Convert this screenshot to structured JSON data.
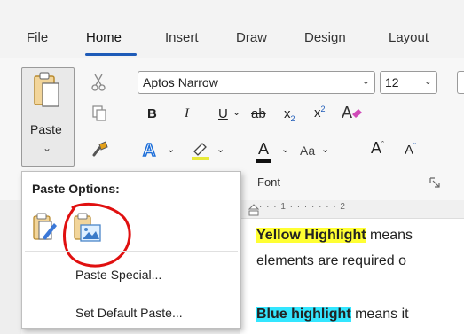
{
  "menu": {
    "items": [
      "File",
      "Home",
      "Insert",
      "Draw",
      "Design",
      "Layout"
    ],
    "active": "Home"
  },
  "clipboard": {
    "paste_label": "Paste",
    "icons": [
      "paste-icon",
      "cut-icon",
      "copy-icon",
      "format-painter-icon",
      "chevron-down-icon"
    ]
  },
  "font": {
    "name": "Aptos Narrow",
    "size": "12",
    "group_label": "Font",
    "bold": "B",
    "italic": "I",
    "underline": "U",
    "strike": "ab",
    "subscript": "x",
    "superscript": "x",
    "change_case": "Aa",
    "grow": "A",
    "shrink": "A",
    "text_effects": "A",
    "font_color": "A"
  },
  "ruler": {
    "text": "· · · 1 · · · · · · · 2"
  },
  "document": {
    "line1_highlight": "Yellow Highlight",
    "line1_rest": " means",
    "line2": "elements are required o",
    "line3_highlight": "Blue highlight",
    "line3_rest": " means it"
  },
  "paste_options": {
    "title": "Paste Options:",
    "paste_special": "Paste Special...",
    "set_default": "Set Default Paste...",
    "annotation_color": "#e01010"
  },
  "colors": {
    "accent": "#1e5bb8",
    "yellow_highlight": "#ffff33",
    "blue_highlight": "#33e6ff"
  }
}
